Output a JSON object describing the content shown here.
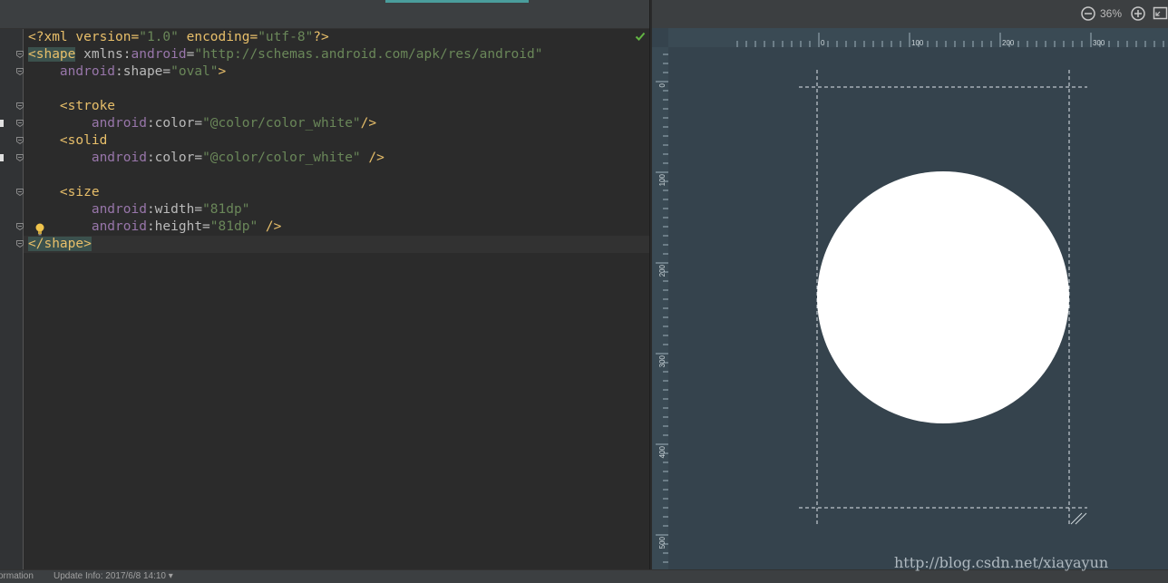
{
  "editor": {
    "lines": [
      [
        {
          "t": "<?xml version=",
          "c": "tag"
        },
        {
          "t": "\"1.0\"",
          "c": "str"
        },
        {
          "t": " encoding=",
          "c": "tag"
        },
        {
          "t": "\"utf-8\"",
          "c": "str"
        },
        {
          "t": "?>",
          "c": "tag"
        }
      ],
      [
        {
          "t": "<shape",
          "c": "tag hl"
        },
        {
          "t": " xmlns:",
          "c": "attr"
        },
        {
          "t": "android",
          "c": "ns"
        },
        {
          "t": "=",
          "c": "attr"
        },
        {
          "t": "\"http://schemas.android.com/apk/res/android\"",
          "c": "str"
        }
      ],
      [
        {
          "t": "    ",
          "c": ""
        },
        {
          "t": "android",
          "c": "ns"
        },
        {
          "t": ":shape=",
          "c": "attr"
        },
        {
          "t": "\"oval\"",
          "c": "str"
        },
        {
          "t": ">",
          "c": "tag"
        }
      ],
      [],
      [
        {
          "t": "    ",
          "c": ""
        },
        {
          "t": "<stroke",
          "c": "tag"
        }
      ],
      [
        {
          "t": "        ",
          "c": ""
        },
        {
          "t": "android",
          "c": "ns"
        },
        {
          "t": ":color=",
          "c": "attr"
        },
        {
          "t": "\"@color/color_white\"",
          "c": "str"
        },
        {
          "t": "/>",
          "c": "tag"
        }
      ],
      [
        {
          "t": "    ",
          "c": ""
        },
        {
          "t": "<solid",
          "c": "tag"
        }
      ],
      [
        {
          "t": "        ",
          "c": ""
        },
        {
          "t": "android",
          "c": "ns"
        },
        {
          "t": ":color=",
          "c": "attr"
        },
        {
          "t": "\"@color/color_white\"",
          "c": "str"
        },
        {
          "t": " />",
          "c": "tag"
        }
      ],
      [],
      [
        {
          "t": "    ",
          "c": ""
        },
        {
          "t": "<size",
          "c": "tag"
        }
      ],
      [
        {
          "t": "        ",
          "c": ""
        },
        {
          "t": "android",
          "c": "ns"
        },
        {
          "t": ":width=",
          "c": "attr"
        },
        {
          "t": "\"81dp\"",
          "c": "str"
        }
      ],
      [
        {
          "t": "        ",
          "c": ""
        },
        {
          "t": "android",
          "c": "ns"
        },
        {
          "t": ":height=",
          "c": "attr"
        },
        {
          "t": "\"81dp\"",
          "c": "str"
        },
        {
          "t": " />",
          "c": "tag"
        }
      ],
      [
        {
          "t": "</shape>",
          "c": "tag hl"
        }
      ]
    ],
    "fold_lines": [
      1,
      2,
      4,
      5,
      6,
      7,
      9,
      11,
      12
    ],
    "marker_lines": [
      5,
      7
    ],
    "bulb_line": 11,
    "status_icon": "check-icon"
  },
  "preview": {
    "zoom_level": "36%",
    "zoom_out_icon": "zoom-out-icon",
    "zoom_in_icon": "zoom-in-icon",
    "zoom_fit_icon": "zoom-fit-icon",
    "ruler_top_labels": [
      "0",
      "100",
      "200",
      "300"
    ],
    "ruler_left_labels": [
      "0",
      "100",
      "200",
      "300",
      "400",
      "500"
    ],
    "shape_fill": "#ffffff",
    "canvas_bg": "#35434d"
  },
  "statusbar": {
    "left_text": "ormation",
    "update_text": "Update Info: 2017/6/8 14:10 ▾"
  },
  "watermark": "http://blog.csdn.net/xiayayun",
  "colors": {
    "tag": "#e8bf6a",
    "attr": "#bababa",
    "namespace": "#9876aa",
    "string": "#6a8759",
    "editor_bg": "#2b2b2b"
  }
}
